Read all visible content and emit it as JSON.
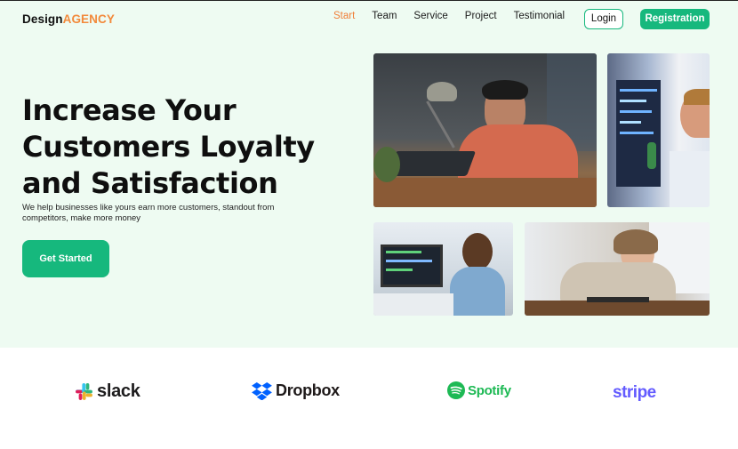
{
  "brand": {
    "part1": "Design",
    "part2": "AGENCY"
  },
  "nav": {
    "items": [
      {
        "label": "Start",
        "active": true
      },
      {
        "label": "Team",
        "active": false
      },
      {
        "label": "Service",
        "active": false
      },
      {
        "label": "Project",
        "active": false
      },
      {
        "label": "Testimonial",
        "active": false
      }
    ],
    "login_label": "Login",
    "register_label": "Registration"
  },
  "hero": {
    "headline_lines": [
      "Increase Your",
      "Customers Loyalty",
      "and Satisfaction"
    ],
    "subtext": "We help businesses like yours earn more customers, standout from competitors, make more money",
    "cta_label": "Get Started"
  },
  "partners": [
    {
      "name": "slack",
      "icon": "slack-logo-icon"
    },
    {
      "name": "Dropbox",
      "icon": "dropbox-logo-icon"
    },
    {
      "name": "Spotify",
      "icon": "spotify-logo-icon"
    },
    {
      "name": "stripe",
      "icon": "stripe-logo-icon"
    }
  ],
  "colors": {
    "accent_green": "#16b87d",
    "accent_orange": "#f07f39",
    "hero_background": "#eefbf2"
  }
}
